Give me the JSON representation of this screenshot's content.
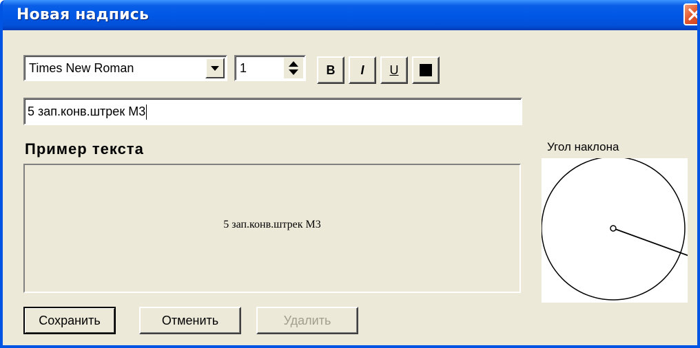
{
  "window": {
    "title": "Новая надпись"
  },
  "toolbar": {
    "font_name": "Times New Roman",
    "font_size": "1",
    "bold_label": "B",
    "italic_label": "I",
    "underline_label": "U",
    "text_color": "#000000"
  },
  "text_input": {
    "value": "5 зап.конв.штрек М3"
  },
  "preview": {
    "heading": "Пример текста",
    "sample_text": "5 зап.конв.штрек М3"
  },
  "angle": {
    "label": "Угол наклона",
    "degrees": -20
  },
  "buttons": {
    "save": "Сохранить",
    "cancel": "Отменить",
    "delete": "Удалить"
  },
  "colors": {
    "titlebar": "#0058E6",
    "window_bg": "#ECE9D8",
    "close": "#E2582E",
    "disabled_text": "#A09E8C"
  },
  "icons": {
    "close": "close-icon",
    "dropdown": "chevron-down-icon",
    "spinner": "spinner-icon",
    "color": "color-swatch-icon"
  }
}
